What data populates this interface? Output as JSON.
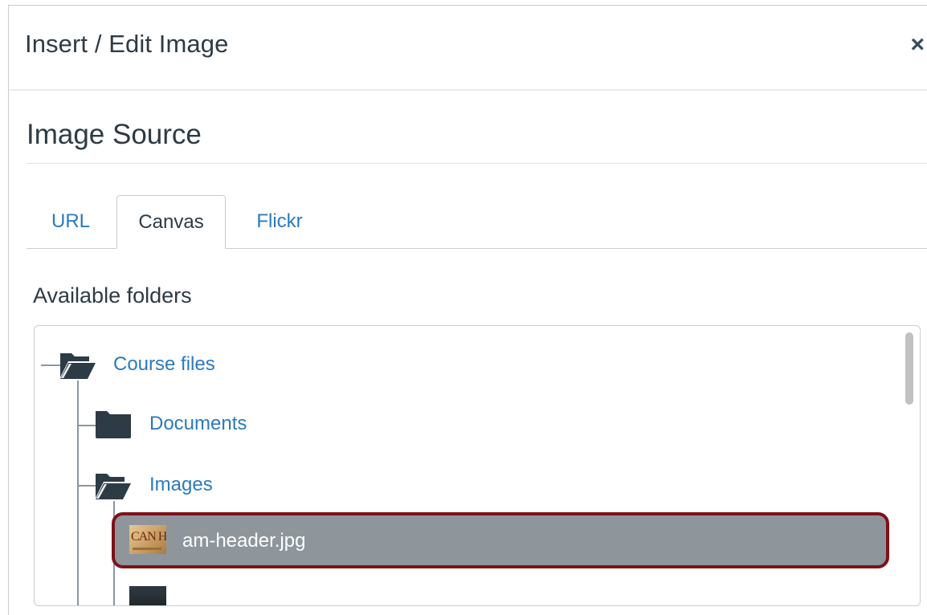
{
  "dialog": {
    "title": "Insert / Edit Image",
    "close_label": "×"
  },
  "source": {
    "title": "Image Source",
    "tabs": [
      {
        "label": "URL",
        "active": false
      },
      {
        "label": "Canvas",
        "active": true
      },
      {
        "label": "Flickr",
        "active": false
      }
    ]
  },
  "folders": {
    "label": "Available folders",
    "items": [
      {
        "label": "Course files",
        "icon": "folder-open-icon"
      },
      {
        "label": "Documents",
        "icon": "folder-closed-icon"
      },
      {
        "label": "Images",
        "icon": "folder-open-icon"
      }
    ],
    "files": [
      {
        "name": "am-header.jpg",
        "thumb_text": "CAN H",
        "selected": true
      },
      {
        "name": "",
        "thumb_text": "",
        "selected": false
      }
    ]
  },
  "colors": {
    "link": "#2b7abc",
    "text": "#2d3b45",
    "selected_row": "#8e969c",
    "highlight_border": "#7d1218",
    "folder_icon": "#2d3b45"
  }
}
